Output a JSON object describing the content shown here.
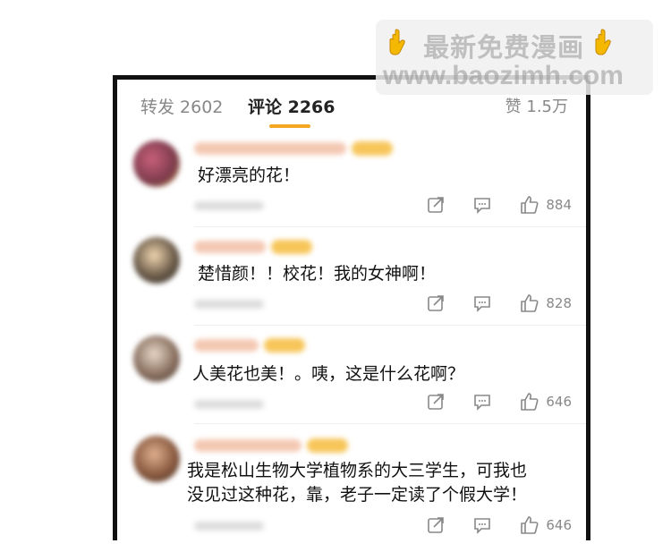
{
  "tabs": {
    "repost_label": "转发 2602",
    "comment_label": "评论 2266",
    "likes_label": "赞 1.5万"
  },
  "colors": {
    "accent": "#f5a623",
    "text": "#111111",
    "muted": "#888888"
  },
  "comments": [
    {
      "text": "好漂亮的花！",
      "likes": "884"
    },
    {
      "text": "楚惜颜！！校花！我的女神啊！",
      "likes": "828"
    },
    {
      "text": "人美花也美！。咦，这是什么花啊？",
      "likes": "646"
    },
    {
      "text": "我是松山生物大学植物系的大三学生，可我也\n没见过这种花，靠，老子一定读了个假大学！",
      "likes": "646"
    }
  ],
  "watermark": {
    "line1": "最新免费漫画",
    "line2": "www.baozimh.com",
    "hand_icon": "pointing-down-hand-icon"
  }
}
